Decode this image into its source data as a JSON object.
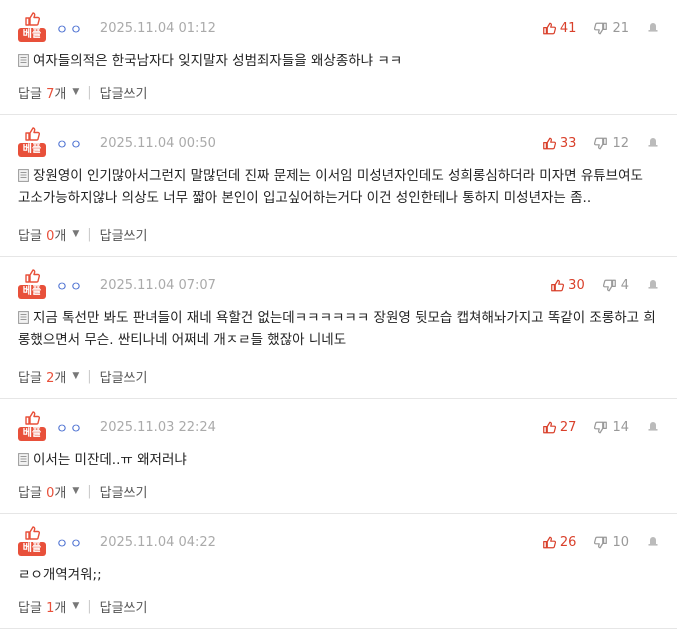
{
  "best_label": "베플",
  "reply_prefix": "답글",
  "reply_unit": "개",
  "write_reply": "답글쓰기",
  "comments": [
    {
      "nick": "ㅇㅇ",
      "date": "2025.11.04 01:12",
      "likes": "41",
      "dislikes": "21",
      "text": "여자들의적은 한국남자다 잊지말자 성범죄자들을 왜상종하냐 ㅋㅋ",
      "reply_count": "7"
    },
    {
      "nick": "ㅇㅇ",
      "date": "2025.11.04 00:50",
      "likes": "33",
      "dislikes": "12",
      "text": "장원영이 인기많아서그런지 말많던데 진짜 문제는 이서임 미성년자인데도 성희롱심하더라 미자면 유튜브여도 고소가능하지않나 의상도 너무 짧아 본인이 입고싶어하는거다 이건 성인한테나 통하지 미성년자는 좀..",
      "reply_count": "0"
    },
    {
      "nick": "ㅇㅇ",
      "date": "2025.11.04 07:07",
      "likes": "30",
      "dislikes": "4",
      "text": "지금 톡선만 봐도 판녀들이 재네 욕할건 없는데ㅋㅋㅋㅋㅋㅋ 장원영 뒷모습 캡쳐해놔가지고 똑같이 조롱하고 희롱했으면서 무슨. 싼티나네 어쩌네 개ㅈㄹ들 했잖아 니네도",
      "reply_count": "2"
    },
    {
      "nick": "ㅇㅇ",
      "date": "2025.11.03 22:24",
      "likes": "27",
      "dislikes": "14",
      "text": "이서는 미잔데..ㅠ 왜저러냐",
      "reply_count": "0"
    },
    {
      "nick": "ㅇㅇ",
      "date": "2025.11.04 04:22",
      "likes": "26",
      "dislikes": "10",
      "text": "ㄹㅇ개역겨워;;",
      "reply_count": "1",
      "no_doc_icon": true
    }
  ]
}
